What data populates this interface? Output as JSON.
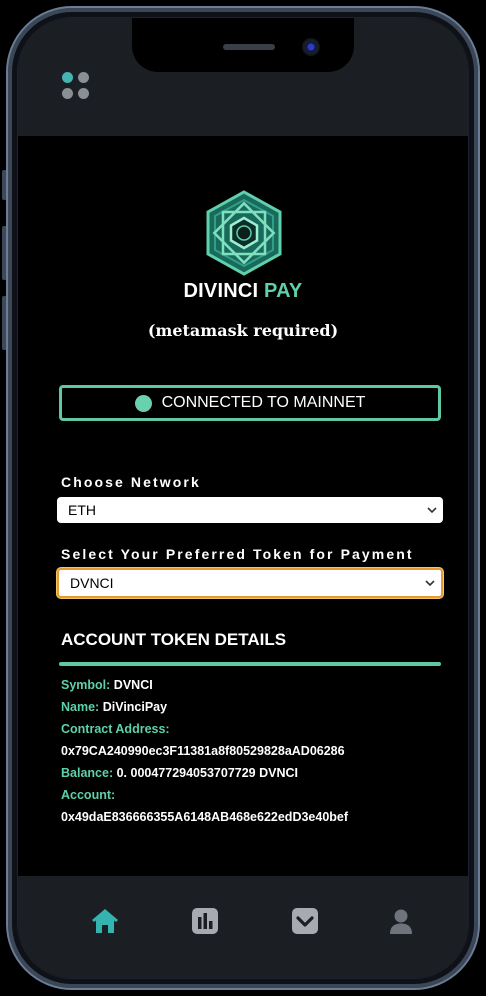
{
  "brand": {
    "name_white": "DIVINCI",
    "name_accent": "PAY"
  },
  "subtitle": "(metamask required)",
  "status": {
    "text": "CONNECTED TO MAINNET"
  },
  "network": {
    "label": "Choose Network",
    "selected": "ETH"
  },
  "token": {
    "label": "Select Your Preferred Token for Payment",
    "selected": "DVNCI"
  },
  "details": {
    "title": "ACCOUNT TOKEN DETAILS",
    "symbol_label": "Symbol:",
    "symbol_value": "DVNCI",
    "name_label": "Name:",
    "name_value": "DiVinciPay",
    "contract_label": "Contract Address:",
    "contract_value": "0x79CA240990ec3F11381a8f80529828aAD06286",
    "balance_label": "Balance:",
    "balance_value": "0. 000477294053707729 DVNCI",
    "account_label": "Account:",
    "account_value": "0x49daE836666355A6148AB468e622edD3e40bef"
  },
  "icons": {
    "menu": "dots-grid-icon",
    "home": "home-icon",
    "chart": "bar-chart-icon",
    "inbox": "chevron-box-icon",
    "profile": "user-icon",
    "logo": "hexagon-logo-icon"
  },
  "colors": {
    "accent": "#5ed0ab",
    "home_active": "#34b3b0",
    "nav_inactive": "#a7abb1",
    "select_focus": "#e69a2f"
  }
}
